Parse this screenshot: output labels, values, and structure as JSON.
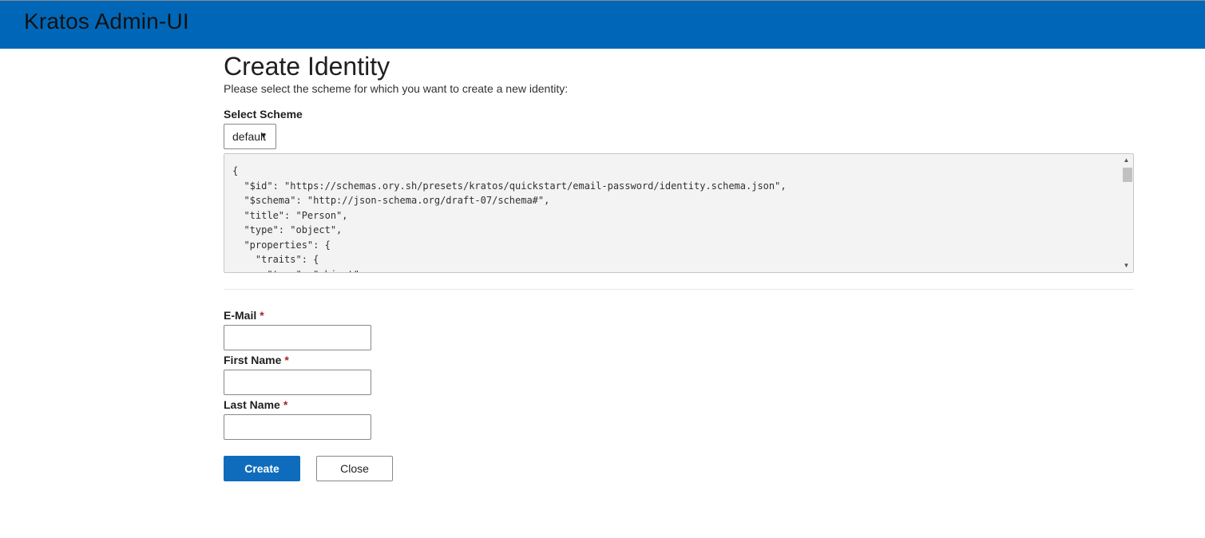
{
  "app": {
    "title": "Kratos Admin-UI"
  },
  "page": {
    "title": "Create Identity",
    "subtitle": "Please select the scheme for which you want to create a new identity:"
  },
  "scheme": {
    "label": "Select Scheme",
    "selected": "default",
    "options": [
      "default"
    ]
  },
  "schema_preview": "{\n  \"$id\": \"https://schemas.ory.sh/presets/kratos/quickstart/email-password/identity.schema.json\",\n  \"$schema\": \"http://json-schema.org/draft-07/schema#\",\n  \"title\": \"Person\",\n  \"type\": \"object\",\n  \"properties\": {\n    \"traits\": {\n      \"type\": \"object\",",
  "form": {
    "required_marker": "*",
    "email": {
      "label": "E-Mail",
      "value": ""
    },
    "first_name": {
      "label": "First Name",
      "value": ""
    },
    "last_name": {
      "label": "Last Name",
      "value": ""
    }
  },
  "actions": {
    "create_label": "Create",
    "close_label": "Close"
  },
  "colors": {
    "header_bg": "#0067b8",
    "primary_button": "#0f6cbd",
    "required_marker": "#a4262c",
    "code_bg": "#f3f3f3"
  },
  "icons": {
    "select_caret": "chevron-down-icon",
    "scroll_up": "arrow-up-icon",
    "scroll_down": "arrow-down-icon"
  }
}
